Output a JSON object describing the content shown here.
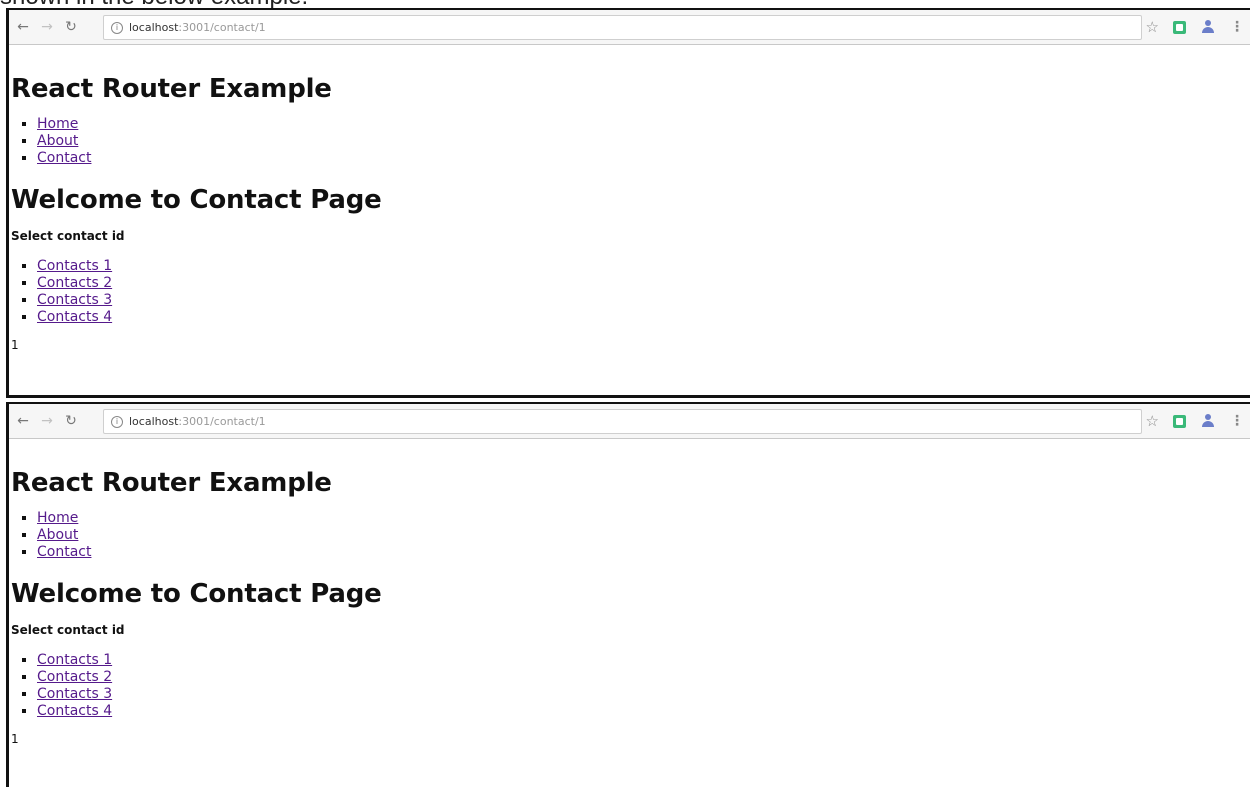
{
  "caption": "shown in the below example.",
  "screens": [
    {
      "url_host": "localhost",
      "url_rest": ":3001/contact/1",
      "app_title": "React Router Example",
      "nav": [
        "Home",
        "About",
        "Contact"
      ],
      "page_title": "Welcome to Contact Page",
      "select_label": "Select contact id",
      "contacts": [
        "Contacts 1",
        "Contacts 2",
        "Contacts 3",
        "Contacts 4"
      ],
      "id_value": "1"
    },
    {
      "url_host": "localhost",
      "url_rest": ":3001/contact/1",
      "app_title": "React Router Example",
      "nav": [
        "Home",
        "About",
        "Contact"
      ],
      "page_title": "Welcome to Contact Page",
      "select_label": "Select contact id",
      "contacts": [
        "Contacts 1",
        "Contacts 2",
        "Contacts 3",
        "Contacts 4"
      ],
      "id_value": "1"
    }
  ],
  "icons": {
    "back": "back-arrow-icon",
    "forward": "forward-arrow-icon",
    "reload": "reload-icon",
    "info": "info-icon",
    "star": "star-icon",
    "extension_green": "extension-icon",
    "extension_person": "person-icon",
    "menu": "menu-icon"
  },
  "colors": {
    "visited_link": "#551a8b",
    "extension_green": "#3ab979",
    "extension_person": "#6b7ec9"
  }
}
